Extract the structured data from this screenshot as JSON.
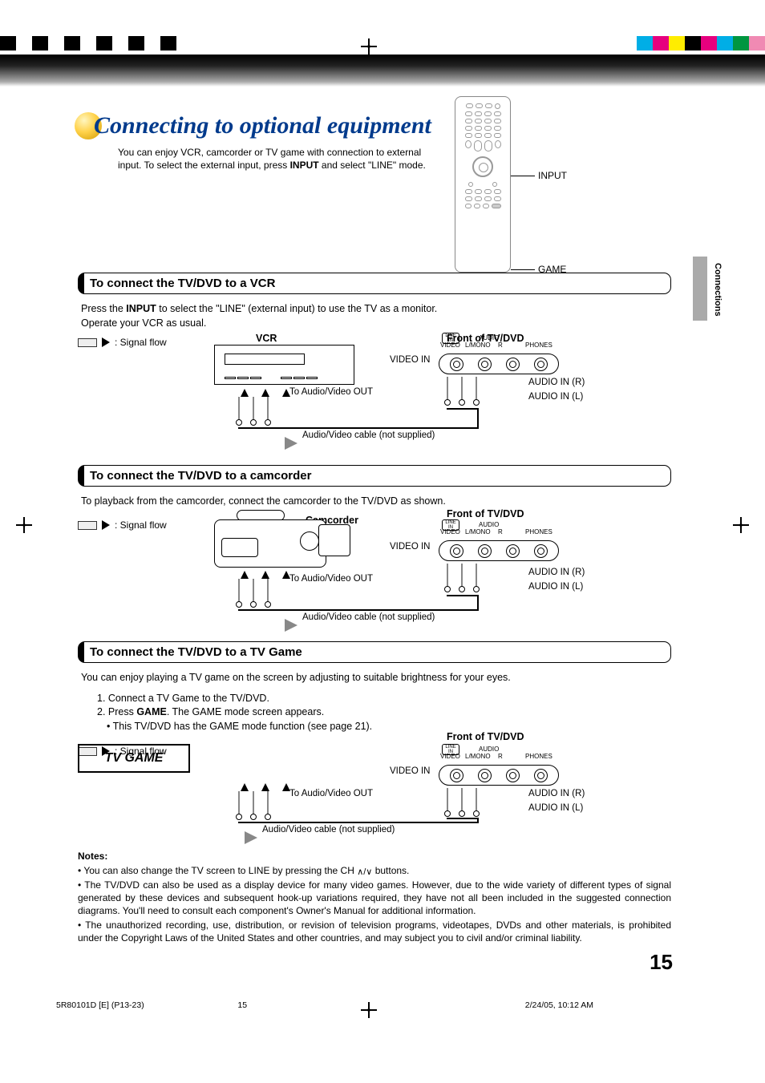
{
  "cropmarks": {
    "left_colors": [
      "#000",
      "#fff",
      "#000",
      "#fff",
      "#000",
      "#fff",
      "#000",
      "#fff",
      "#000",
      "#fff",
      "#000",
      "#fff"
    ],
    "right_colors": [
      "#00aee6",
      "#e6007e",
      "#ffed00",
      "#000",
      "#e6007e",
      "#00aee6",
      "#009640",
      "#f08ab3"
    ]
  },
  "title": "Connecting to optional equipment",
  "intro_line1": "You can enjoy VCR, camcorder or TV game with connection to external",
  "intro_line2_a": "input. To select the external input, press ",
  "intro_line2_b": "INPUT",
  "intro_line2_c": " and select \"LINE\" mode.",
  "remote_callouts": {
    "input": "INPUT",
    "game": "GAME"
  },
  "side_tab": "Connections",
  "sections": [
    {
      "header": "To connect the TV/DVD to a VCR",
      "body_a": "Press the ",
      "body_b": "INPUT",
      "body_c": " to select the \"LINE\" (external input) to use the TV as a monitor.",
      "body2": "Operate your VCR as usual.",
      "device_title": "VCR"
    },
    {
      "header": "To connect the TV/DVD to a camcorder",
      "body": "To playback from the camcorder, connect the camcorder to the TV/DVD as shown.",
      "device_title": "Camcorder"
    },
    {
      "header": "To connect the TV/DVD to a TV Game",
      "body": "You can enjoy playing a TV game on the screen by adjusting to suitable brightness for your eyes.",
      "step1": "1. Connect a TV Game to the TV/DVD.",
      "step2a": "2. Press ",
      "step2b": "GAME",
      "step2c": ". The GAME mode screen appears.",
      "bullet": "• This TV/DVD has the GAME mode function (see page 21).",
      "device_title": "TV GAME"
    }
  ],
  "common_labels": {
    "signal_flow": " : Signal flow",
    "front_label": "Front of TV/DVD",
    "video_in": "VIDEO IN",
    "to_av_out": "To Audio/Video OUT",
    "audio_r": "AUDIO IN (R)",
    "audio_l": "AUDIO IN (L)",
    "cable": "Audio/Video cable (not supplied)",
    "jack_top": {
      "linein": "LINE IN",
      "video": "VIDEO",
      "lmono": "L/MONO",
      "r": "R",
      "audio": "AUDIO",
      "phones": "PHONES"
    }
  },
  "notes": {
    "title": "Notes:",
    "n1a": "• You can also change the TV screen to LINE by pressing the CH ",
    "n1b": " buttons.",
    "n2": "• The TV/DVD can also be used as a display device for many video games. However, due to the wide variety of different types of signal generated by these devices and subsequent hook-up variations required, they have not all been included in the suggested connection diagrams. You'll need to consult each component's Owner's Manual for additional information.",
    "n3": "• The unauthorized recording, use, distribution, or revision of television programs, videotapes, DVDs and other materials, is prohibited under the Copyright Laws of the United States and other countries, and may subject you to civil and/or criminal liability."
  },
  "page_number": "15",
  "footer": {
    "doc": "5R80101D [E] (P13-23)",
    "page": "15",
    "date": "2/24/05, 10:12 AM"
  }
}
